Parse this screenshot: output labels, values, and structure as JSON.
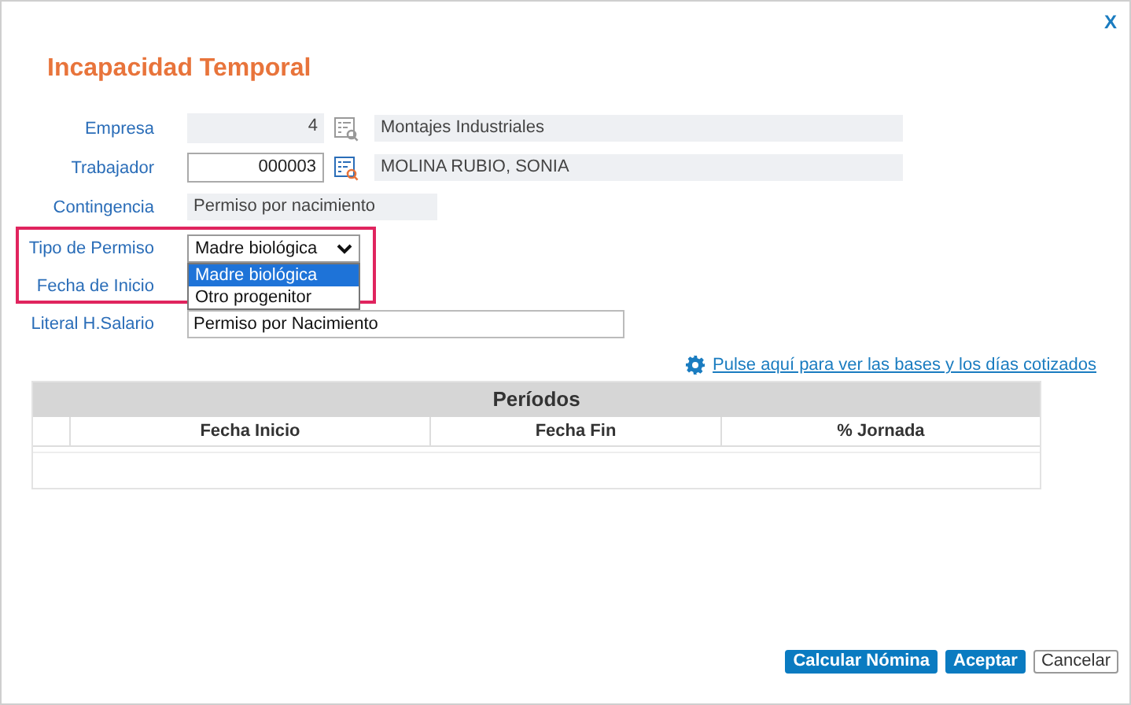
{
  "window": {
    "title": "Incapacidad Temporal",
    "close": "X"
  },
  "fields": [
    {
      "kind": "lookup",
      "label": "Empresa",
      "code": "4",
      "editable": false,
      "name": "Montajes Industriales",
      "highlighted": false
    },
    {
      "kind": "lookup",
      "label": "Trabajador",
      "code": "000003",
      "editable": true,
      "name": "MOLINA RUBIO, SONIA",
      "highlighted": false
    },
    {
      "kind": "readonly",
      "label": "Contingencia",
      "value": "Permiso por nacimiento",
      "highlighted": false
    },
    {
      "kind": "select",
      "label": "Tipo de Permiso",
      "value": "Madre biológica",
      "expanded": true,
      "highlighted": true,
      "options": [
        {
          "label": "Madre biológica",
          "selected": true
        },
        {
          "label": "Otro progenitor",
          "selected": false
        }
      ]
    },
    {
      "kind": "empty",
      "label": "Fecha de Inicio",
      "highlighted": true
    },
    {
      "kind": "text",
      "label": "Literal H.Salario",
      "value": "Permiso por Nacimiento",
      "highlighted": false
    }
  ],
  "link": "Pulse aquí para ver las bases y los días cotizados",
  "table": {
    "title": "Períodos",
    "columns": [
      "Fecha Inicio",
      "Fecha Fin",
      "% Jornada"
    ]
  },
  "buttons": [
    {
      "label": "Calcular Nómina",
      "kind": "primary"
    },
    {
      "label": "Aceptar",
      "kind": "primary"
    },
    {
      "label": "Cancelar",
      "kind": "secondary"
    }
  ]
}
